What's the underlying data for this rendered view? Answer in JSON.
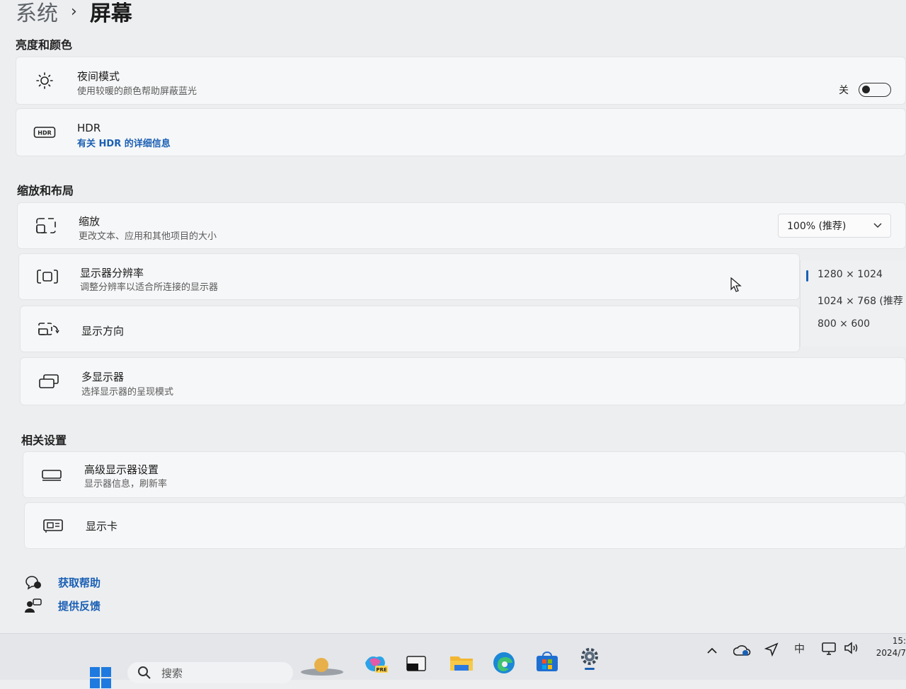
{
  "breadcrumb": {
    "parent": "系统",
    "separator": "›",
    "current": "屏幕"
  },
  "sections": {
    "brightness": "亮度和颜色",
    "scale_layout": "缩放和布局",
    "related": "相关设置"
  },
  "night_mode": {
    "title": "夜间模式",
    "subtitle": "使用较暖的颜色帮助屏蔽蓝光",
    "state_label": "关",
    "on": false
  },
  "hdr": {
    "title": "HDR",
    "link": "有关 HDR 的详细信息",
    "icon_text": "HDR"
  },
  "scale": {
    "title": "缩放",
    "subtitle": "更改文本、应用和其他项目的大小",
    "value": "100% (推荐)"
  },
  "resolution": {
    "title": "显示器分辨率",
    "subtitle": "调整分辨率以适合所连接的显示器",
    "options": [
      "1280 × 1024",
      "1024 × 768 (推荐",
      "800 × 600"
    ],
    "selected_index": 0
  },
  "orientation": {
    "title": "显示方向"
  },
  "multi_display": {
    "title": "多显示器",
    "subtitle": "选择显示器的呈现模式"
  },
  "advanced": {
    "title": "高级显示器设置",
    "subtitle": "显示器信息，刷新率"
  },
  "gpu": {
    "title": "显示卡"
  },
  "help": {
    "get_help": "获取帮助",
    "feedback": "提供反馈"
  },
  "taskbar": {
    "search_placeholder": "搜索",
    "ime": "中",
    "time": "15:",
    "date": "2024/7",
    "copilot_badge": "PRE"
  },
  "colors": {
    "accent": "#1a5fb4",
    "card": "#f6f7f8",
    "background": "#eceef0"
  }
}
